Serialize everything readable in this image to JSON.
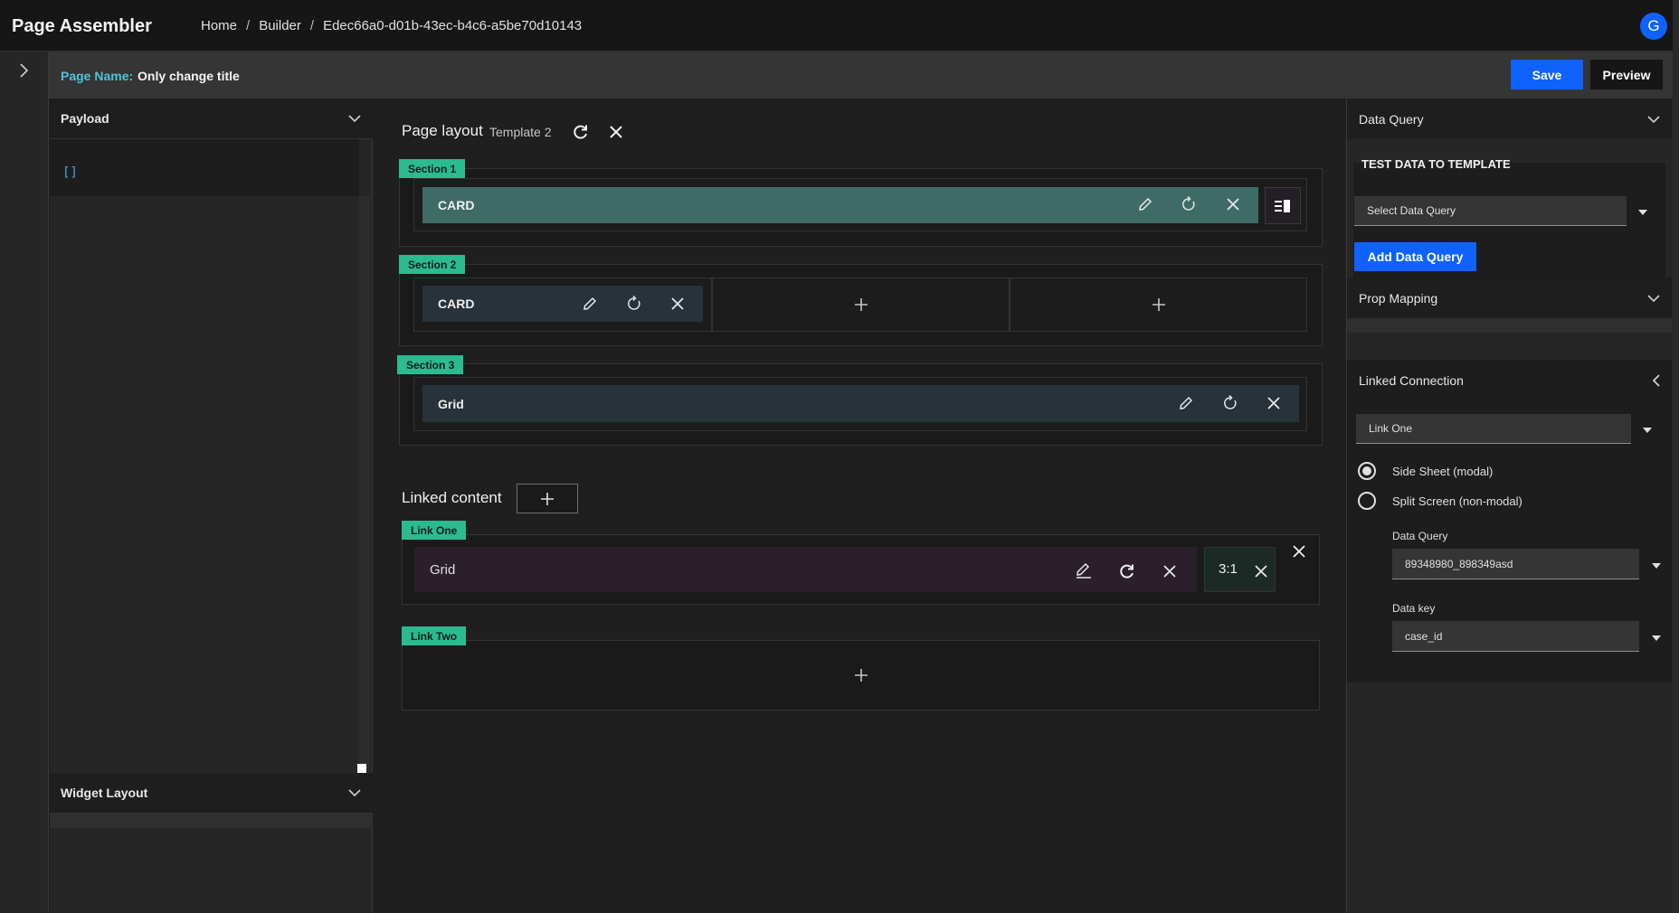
{
  "header": {
    "app_title": "Page Assembler",
    "breadcrumbs": [
      "Home",
      "Builder",
      "Edec66a0-d01b-43ec-b4c6-a5be70d10143"
    ],
    "breadcrumb_separator": "/",
    "avatar_initial": "G"
  },
  "page_name_bar": {
    "label": "Page Name:",
    "value": "Only change title",
    "save_label": "Save",
    "preview_label": "Preview"
  },
  "left_panel": {
    "payload_title": "Payload",
    "payload_value": "[]",
    "widget_layout_title": "Widget Layout"
  },
  "page_layout": {
    "title": "Page layout",
    "template": "Template 2",
    "sections": [
      {
        "tag": "Section 1",
        "cards": [
          {
            "label": "CARD"
          }
        ]
      },
      {
        "tag": "Section 2",
        "cards": [
          {
            "label": "CARD"
          }
        ],
        "empty_slots": 2
      },
      {
        "tag": "Section 3",
        "cards": [
          {
            "label": "Grid"
          }
        ]
      }
    ]
  },
  "linked_content": {
    "title": "Linked content",
    "links": [
      {
        "tag": "Link One",
        "card_label": "Grid",
        "ratio": "3:1"
      },
      {
        "tag": "Link Two"
      }
    ]
  },
  "right_panel": {
    "data_query_title": "Data Query",
    "test_data_heading": "TEST DATA TO TEMPLATE",
    "select_placeholder": "Select Data Query",
    "add_button": "Add Data Query",
    "prop_mapping_title": "Prop Mapping",
    "linked_connection_title": "Linked Connection",
    "link_select": "Link One",
    "radio_options": [
      {
        "label": "Side Sheet (modal)",
        "selected": true
      },
      {
        "label": "Split Screen (non-modal)",
        "selected": false
      }
    ],
    "data_query_label": "Data Query",
    "data_query_value": "89348980_898349asd",
    "data_key_label": "Data key",
    "data_key_value": "case_id"
  },
  "colors": {
    "accent_blue": "#0f62fe",
    "tag_green": "#2bbb8f",
    "card_teal": "#3f6b66",
    "card_slate": "#27323a",
    "card_purple": "#2a1f2a",
    "label_cyan": "#4fc3d8"
  },
  "icons": [
    "chevron-right-icon",
    "chevron-down-icon",
    "chevron-left-icon",
    "refresh-icon",
    "close-icon",
    "edit-icon",
    "reset-icon",
    "plus-icon",
    "layout-icon"
  ]
}
